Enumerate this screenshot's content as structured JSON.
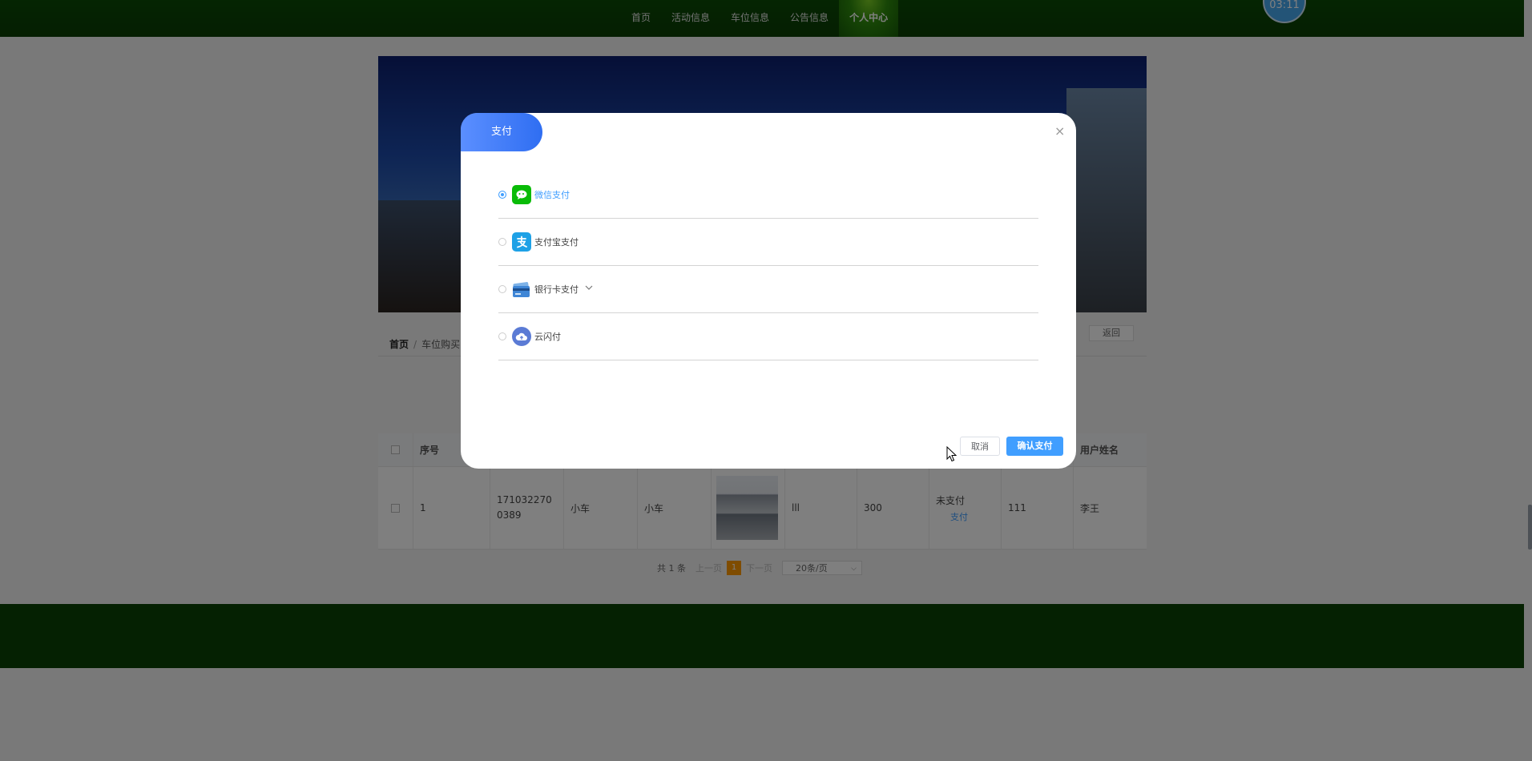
{
  "nav": {
    "items": [
      {
        "label": "首页"
      },
      {
        "label": "活动信息"
      },
      {
        "label": "车位信息"
      },
      {
        "label": "公告信息"
      },
      {
        "label": "个人中心",
        "active": true
      }
    ],
    "clock": "03:11"
  },
  "breadcrumb": {
    "home": "首页",
    "sep": "/",
    "current": "车位购买"
  },
  "back_label": "返回",
  "table": {
    "headers": [
      "序号",
      "用户姓名"
    ],
    "row": {
      "index": "1",
      "order_no": "1710322700389",
      "type": "小车",
      "name": "小车",
      "area": "lll",
      "price": "300",
      "status": "未支付",
      "pay_link": "支付",
      "account": "111",
      "user": "李王"
    }
  },
  "pager": {
    "total": "共 1 条",
    "prev": "上一页",
    "page": "1",
    "next": "下一页",
    "size": "20条/页"
  },
  "modal": {
    "title": "支付",
    "close": "×",
    "options": [
      {
        "label": "微信支付",
        "icon": "wechat-pay-icon",
        "color": "#09bb07",
        "selected": true
      },
      {
        "label": "支付宝支付",
        "icon": "alipay-icon",
        "color": "#1ea1e6",
        "selected": false
      },
      {
        "label": "银行卡支付",
        "icon": "bank-card-icon",
        "color": "#4a90d9",
        "selected": false
      },
      {
        "label": "云闪付",
        "icon": "unionpay-cloud-icon",
        "color": "#5b7bd5",
        "selected": false
      }
    ],
    "cancel_label": "取消",
    "confirm_label": "确认支付"
  },
  "colors": {
    "nav_bg": "#0b4505",
    "footer_bg": "#0b4204",
    "accent": "#409eff",
    "tab_gradient": "#2f6ef2",
    "page_num": "#ff9800"
  }
}
